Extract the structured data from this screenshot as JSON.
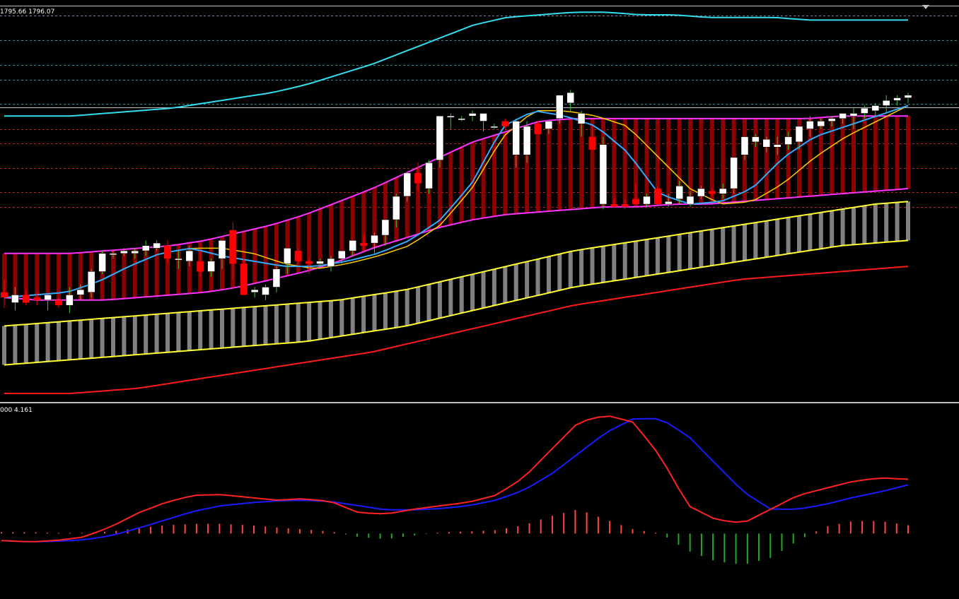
{
  "main_panel": {
    "price_readout": "1795.66 1796.07"
  },
  "sub_panel": {
    "indicator_readout": "000 4.161"
  },
  "colors": {
    "background": "#000000",
    "bull_candle": "#ffffff",
    "bear_candle": "#ff0000",
    "band_fill": "#8b0000",
    "band_line": "#ff33ff",
    "outer_band": "#33ddee",
    "fast_ma": "#33aaff",
    "slow_ma": "#ffcc00",
    "lower_band_line": "#ffff33",
    "lower_band_fill": "#808080",
    "long_ma": "#ff1a1a",
    "macd_fast": "#ff2222",
    "macd_signal": "#1a1aff",
    "hist_pos": "#ff4444",
    "hist_neg": "#22aa22"
  },
  "chart_data": [
    {
      "type": "candlestick",
      "title": "",
      "notes": "price values are estimated relative levels read from the plot (no price axis visible)",
      "candles": [
        {
          "o": 40,
          "h": 45,
          "l": 34,
          "c": 38
        },
        {
          "o": 36,
          "h": 42,
          "l": 33,
          "c": 39
        },
        {
          "o": 39,
          "h": 41,
          "l": 35,
          "c": 36
        },
        {
          "o": 38,
          "h": 40,
          "l": 35,
          "c": 37
        },
        {
          "o": 37,
          "h": 39,
          "l": 33,
          "c": 39
        },
        {
          "o": 37,
          "h": 38,
          "l": 34,
          "c": 35
        },
        {
          "o": 35,
          "h": 42,
          "l": 32,
          "c": 39
        },
        {
          "o": 39,
          "h": 43,
          "l": 37,
          "c": 41
        },
        {
          "o": 40,
          "h": 49,
          "l": 38,
          "c": 48
        },
        {
          "o": 48,
          "h": 56,
          "l": 47,
          "c": 55
        },
        {
          "o": 55,
          "h": 56,
          "l": 53,
          "c": 55
        },
        {
          "o": 55,
          "h": 57,
          "l": 54,
          "c": 56
        },
        {
          "o": 55,
          "h": 57,
          "l": 53,
          "c": 56
        },
        {
          "o": 56,
          "h": 60,
          "l": 54,
          "c": 58
        },
        {
          "o": 57,
          "h": 60,
          "l": 56,
          "c": 59
        },
        {
          "o": 58,
          "h": 60,
          "l": 51,
          "c": 53
        },
        {
          "o": 53,
          "h": 56,
          "l": 49,
          "c": 53
        },
        {
          "o": 52,
          "h": 58,
          "l": 50,
          "c": 56
        },
        {
          "o": 52,
          "h": 56,
          "l": 46,
          "c": 48
        },
        {
          "o": 48,
          "h": 53,
          "l": 46,
          "c": 52
        },
        {
          "o": 53,
          "h": 60,
          "l": 49,
          "c": 60
        },
        {
          "o": 64,
          "h": 67,
          "l": 45,
          "c": 51
        },
        {
          "o": 51,
          "h": 53,
          "l": 39,
          "c": 39
        },
        {
          "o": 40,
          "h": 42,
          "l": 38,
          "c": 41
        },
        {
          "o": 39,
          "h": 43,
          "l": 37,
          "c": 42
        },
        {
          "o": 42,
          "h": 50,
          "l": 40,
          "c": 49
        },
        {
          "o": 51,
          "h": 57,
          "l": 47,
          "c": 57
        },
        {
          "o": 56,
          "h": 57,
          "l": 51,
          "c": 52
        },
        {
          "o": 52,
          "h": 53,
          "l": 47,
          "c": 51
        },
        {
          "o": 51,
          "h": 53,
          "l": 50,
          "c": 52
        },
        {
          "o": 50,
          "h": 54,
          "l": 48,
          "c": 53
        },
        {
          "o": 53,
          "h": 56,
          "l": 51,
          "c": 56
        },
        {
          "o": 56,
          "h": 60,
          "l": 54,
          "c": 60
        },
        {
          "o": 59,
          "h": 62,
          "l": 56,
          "c": 58
        },
        {
          "o": 59,
          "h": 63,
          "l": 55,
          "c": 62
        },
        {
          "o": 62,
          "h": 68,
          "l": 58,
          "c": 68
        },
        {
          "o": 68,
          "h": 78,
          "l": 65,
          "c": 77
        },
        {
          "o": 77,
          "h": 86,
          "l": 75,
          "c": 86
        },
        {
          "o": 86,
          "h": 90,
          "l": 79,
          "c": 82
        },
        {
          "o": 80,
          "h": 91,
          "l": 78,
          "c": 90
        },
        {
          "o": 91,
          "h": 108,
          "l": 88,
          "c": 108
        },
        {
          "o": 108,
          "h": 109,
          "l": 103,
          "c": 108
        },
        {
          "o": 107,
          "h": 108,
          "l": 106,
          "c": 107
        },
        {
          "o": 108,
          "h": 110,
          "l": 106,
          "c": 109
        },
        {
          "o": 106,
          "h": 108,
          "l": 102,
          "c": 109
        },
        {
          "o": 104,
          "h": 105,
          "l": 103,
          "c": 104
        },
        {
          "o": 106,
          "h": 107,
          "l": 103,
          "c": 104
        },
        {
          "o": 93,
          "h": 107,
          "l": 88,
          "c": 106
        },
        {
          "o": 93,
          "h": 106,
          "l": 90,
          "c": 104
        },
        {
          "o": 105,
          "h": 106,
          "l": 101,
          "c": 101
        },
        {
          "o": 103,
          "h": 106,
          "l": 101,
          "c": 106
        },
        {
          "o": 107,
          "h": 116,
          "l": 105,
          "c": 116
        },
        {
          "o": 113,
          "h": 118,
          "l": 110,
          "c": 117
        },
        {
          "o": 105,
          "h": 110,
          "l": 100,
          "c": 109
        },
        {
          "o": 100,
          "h": 104,
          "l": 95,
          "c": 95
        },
        {
          "o": 74,
          "h": 100,
          "l": 72,
          "c": 97
        },
        {
          "o": 74,
          "h": 76,
          "l": 73,
          "c": 73
        },
        {
          "o": 74,
          "h": 76,
          "l": 72,
          "c": 73
        },
        {
          "o": 76,
          "h": 82,
          "l": 74,
          "c": 74
        },
        {
          "o": 74,
          "h": 78,
          "l": 73,
          "c": 77
        },
        {
          "o": 80,
          "h": 81,
          "l": 74,
          "c": 74
        },
        {
          "o": 74,
          "h": 78,
          "l": 73,
          "c": 75
        },
        {
          "o": 76,
          "h": 83,
          "l": 74,
          "c": 81
        },
        {
          "o": 74,
          "h": 79,
          "l": 73,
          "c": 77
        },
        {
          "o": 77,
          "h": 81,
          "l": 76,
          "c": 80
        },
        {
          "o": 79,
          "h": 80,
          "l": 77,
          "c": 78
        },
        {
          "o": 78,
          "h": 82,
          "l": 76,
          "c": 80
        },
        {
          "o": 80,
          "h": 92,
          "l": 78,
          "c": 92
        },
        {
          "o": 93,
          "h": 100,
          "l": 91,
          "c": 100
        },
        {
          "o": 98,
          "h": 101,
          "l": 96,
          "c": 100
        },
        {
          "o": 96,
          "h": 100,
          "l": 94,
          "c": 99
        },
        {
          "o": 96,
          "h": 100,
          "l": 93,
          "c": 97
        },
        {
          "o": 97,
          "h": 102,
          "l": 95,
          "c": 100
        },
        {
          "o": 98,
          "h": 104,
          "l": 95,
          "c": 104
        },
        {
          "o": 103,
          "h": 108,
          "l": 100,
          "c": 106
        },
        {
          "o": 104,
          "h": 107,
          "l": 103,
          "c": 106
        },
        {
          "o": 106,
          "h": 108,
          "l": 104,
          "c": 107
        },
        {
          "o": 107,
          "h": 109,
          "l": 105,
          "c": 109
        },
        {
          "o": 108,
          "h": 111,
          "l": 103,
          "c": 109
        },
        {
          "o": 109,
          "h": 112,
          "l": 107,
          "c": 111
        },
        {
          "o": 110,
          "h": 113,
          "l": 108,
          "c": 112
        },
        {
          "o": 112,
          "h": 116,
          "l": 109,
          "c": 114
        },
        {
          "o": 114,
          "h": 116,
          "l": 112,
          "c": 115
        },
        {
          "o": 115,
          "h": 117,
          "l": 113,
          "c": 116
        }
      ],
      "series": [
        {
          "role": "upper_outer_band",
          "values": [
            108,
            108,
            108,
            109,
            110,
            111,
            113,
            115,
            117,
            120,
            124,
            128,
            133,
            138,
            143,
            146,
            147,
            148,
            148,
            147,
            147,
            146,
            146,
            146,
            145,
            145,
            145,
            145
          ]
        },
        {
          "role": "channel_upper",
          "values": [
            55,
            55,
            55,
            56,
            57,
            58,
            60,
            63,
            66,
            70,
            75,
            80,
            86,
            92,
            98,
            102,
            106,
            107,
            107,
            107,
            107,
            107,
            107,
            107,
            107,
            108,
            108,
            108
          ]
        },
        {
          "role": "channel_lower",
          "values": [
            38,
            37,
            37,
            37,
            38,
            39,
            40,
            42,
            45,
            48,
            52,
            57,
            61,
            65,
            68,
            70,
            71,
            72,
            73,
            73,
            74,
            74,
            75,
            76,
            77,
            78,
            79,
            80
          ]
        },
        {
          "role": "fast_ma",
          "values": [
            38,
            39,
            40,
            44,
            50,
            55,
            57,
            54,
            52,
            50,
            50,
            52,
            55,
            60,
            68,
            82,
            104,
            110,
            108,
            104,
            94,
            78,
            74,
            75,
            80,
            92,
            100,
            104,
            108,
            112
          ]
        },
        {
          "role": "slow_ma",
          "values": [
            38,
            39,
            40,
            44,
            50,
            55,
            57,
            57,
            55,
            51,
            49,
            51,
            54,
            58,
            66,
            80,
            100,
            110,
            110,
            108,
            104,
            92,
            80,
            74,
            75,
            82,
            92,
            100,
            106,
            112
          ]
        },
        {
          "role": "lower_band_top",
          "values": [
            27,
            28,
            29,
            30,
            31,
            32,
            33,
            34,
            35,
            36,
            37,
            39,
            41,
            44,
            47,
            50,
            53,
            56,
            58,
            60,
            62,
            64,
            66,
            68,
            70,
            72,
            74,
            75
          ]
        },
        {
          "role": "lower_band_bottom",
          "values": [
            12,
            13,
            14,
            15,
            16,
            17,
            18,
            19,
            20,
            21,
            23,
            25,
            27,
            30,
            33,
            36,
            39,
            42,
            44,
            46,
            48,
            50,
            52,
            54,
            56,
            58,
            59,
            60
          ]
        },
        {
          "role": "long_ma",
          "values": [
            1,
            1,
            1,
            2,
            3,
            5,
            7,
            9,
            11,
            13,
            15,
            17,
            20,
            23,
            26,
            29,
            32,
            35,
            37,
            39,
            41,
            43,
            45,
            46,
            47,
            48,
            49,
            50
          ]
        }
      ]
    },
    {
      "type": "line",
      "title": "",
      "notes": "oscillator sub-window with histogram; values estimated",
      "series": [
        {
          "role": "oscillator_fast",
          "values": [
            -10,
            -12,
            -10,
            -5,
            10,
            30,
            45,
            55,
            56,
            52,
            48,
            50,
            46,
            30,
            28,
            35,
            40,
            45,
            55,
            80,
            120,
            160,
            170,
            160,
            110,
            40,
            20,
            15,
            35,
            55,
            65,
            75,
            80,
            78
          ]
        },
        {
          "role": "oscillator_signal",
          "values": [
            -10,
            -12,
            -11,
            -9,
            -3,
            8,
            20,
            32,
            40,
            44,
            47,
            48,
            46,
            40,
            34,
            34,
            36,
            40,
            48,
            62,
            85,
            115,
            145,
            165,
            165,
            140,
            100,
            60,
            35,
            35,
            42,
            52,
            60,
            70
          ]
        },
        {
          "role": "histogram",
          "values": [
            2,
            2,
            1,
            1,
            3,
            8,
            12,
            14,
            14,
            12,
            9,
            6,
            3,
            -5,
            -8,
            -3,
            2,
            3,
            5,
            12,
            25,
            35,
            20,
            6,
            0,
            -25,
            -40,
            -45,
            -35,
            -10,
            10,
            18,
            18,
            12
          ]
        }
      ]
    }
  ]
}
